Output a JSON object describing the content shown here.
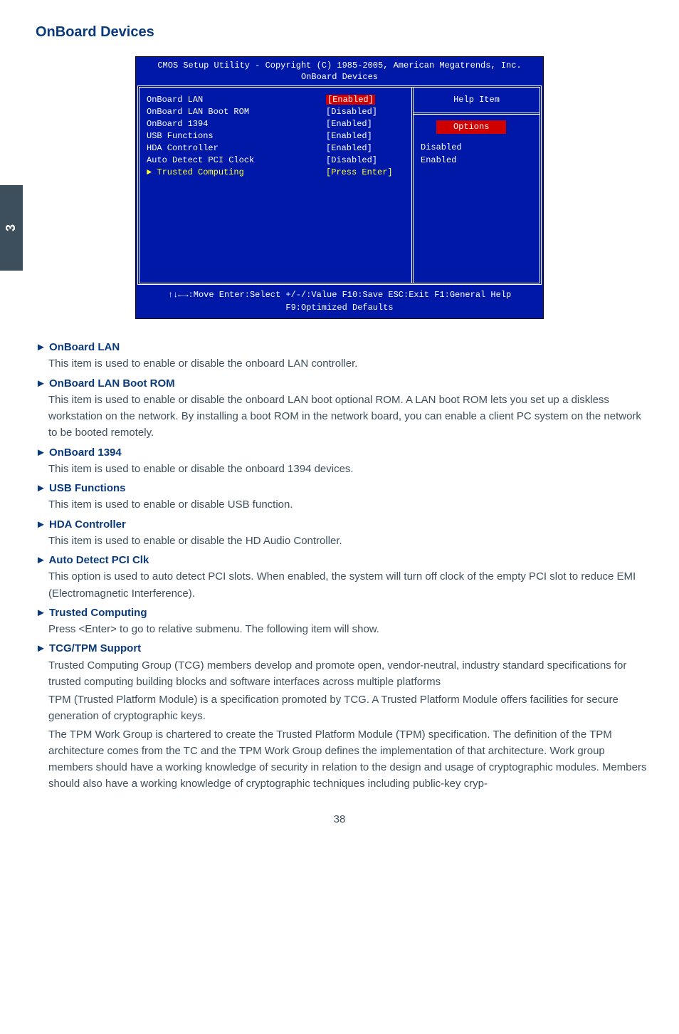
{
  "side_tab": "3",
  "section_title": "OnBoard Devices",
  "bios": {
    "header_line1": "CMOS Setup Utility - Copyright (C) 1985-2005, American Megatrends, Inc.",
    "header_line2": "OnBoard Devices",
    "rows": [
      {
        "label": "OnBoard LAN",
        "value": "[Enabled]",
        "cls": "selected"
      },
      {
        "label": "OnBoard LAN Boot ROM",
        "value": "[Disabled]",
        "cls": ""
      },
      {
        "label": "OnBoard 1394",
        "value": "[Enabled]",
        "cls": ""
      },
      {
        "label": "USB Functions",
        "value": "[Enabled]",
        "cls": ""
      },
      {
        "label": "HDA Controller",
        "value": "[Enabled]",
        "cls": ""
      },
      {
        "label": "Auto Detect PCI Clock",
        "value": "[Disabled]",
        "cls": ""
      },
      {
        "label": "► Trusted Computing",
        "value": "[Press Enter]",
        "cls": "enter"
      }
    ],
    "help_title": "Help Item",
    "opt_pill": "Options",
    "opt_list": [
      "Disabled",
      "Enabled"
    ],
    "foot1": "↑↓←→:Move   Enter:Select    +/-/:Value    F10:Save     ESC:Exit    F1:General Help",
    "foot2": "F9:Optimized Defaults"
  },
  "items": {
    "onboard_lan": {
      "title": "OnBoard LAN",
      "body": "This item is used to enable or disable the onboard LAN controller."
    },
    "boot_rom": {
      "title": "OnBoard LAN Boot ROM",
      "body": "This item is used to enable or disable the onboard LAN boot optional ROM. A LAN boot ROM lets you set up a diskless workstation on the network. By installing a boot ROM in the network board, you can enable a client PC system on the network to be booted remotely."
    },
    "onboard_1394": {
      "title": "OnBoard 1394",
      "body": "This item is used to enable or disable the onboard 1394 devices."
    },
    "usb": {
      "title": "USB Functions",
      "body": "This item is used to enable or disable USB function."
    },
    "hda": {
      "title": "HDA Controller",
      "body": "This item is used to enable or disable the HD Audio Controller."
    },
    "pci": {
      "title": "Auto Detect PCI Clk",
      "body": "This option is used to auto detect PCI slots. When enabled, the system will turn off clock of the empty PCI slot to reduce EMI (Electromagnetic Interference)."
    },
    "trusted": {
      "title": "Trusted Computing",
      "body": "Press <Enter> to go to relative submenu. The following item will show."
    },
    "tcg": {
      "title": "TCG/TPM Support",
      "body1": "Trusted Computing Group (TCG) members develop and promote open, vendor-neutral, industry standard specifications for trusted computing building blocks and software interfaces across multiple platforms",
      "body2": "TPM (Trusted Platform Module) is a specification promoted by TCG. A Trusted Platform Module offers facilities for secure generation of cryptographic keys.",
      "body3": "The TPM Work Group is chartered to create the Trusted Platform Module (TPM) specification. The definition of the TPM architecture comes from the TC and the TPM Work Group defines the implementation of that architecture. Work group members should have a working knowledge of security in relation to the design and usage of cryptographic modules. Members should also have a working knowledge of cryptographic techniques including public-key cryp-"
    }
  },
  "page_number": "38"
}
